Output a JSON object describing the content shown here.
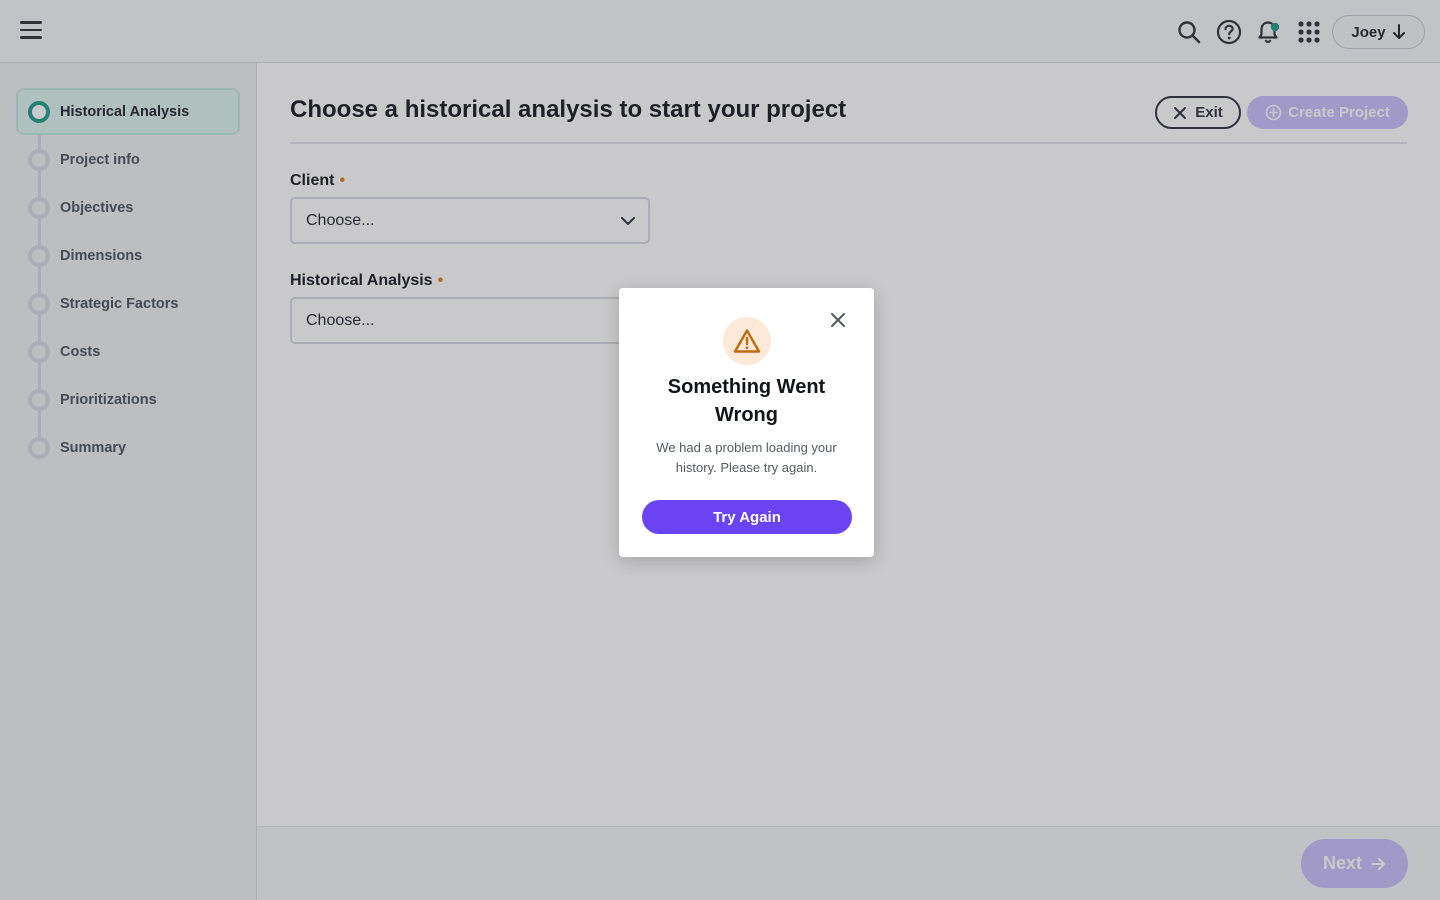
{
  "header": {
    "menu_icon": "hamburger-menu-icon",
    "icons": [
      "search-icon",
      "help-icon",
      "bell-icon",
      "apps-grid-icon"
    ],
    "notification_dot_color": "#1d9a8a",
    "user_name": "Joey"
  },
  "sidebar": {
    "steps": [
      {
        "label": "Historical Analysis",
        "active": true
      },
      {
        "label": "Project info",
        "active": false
      },
      {
        "label": "Objectives",
        "active": false
      },
      {
        "label": "Dimensions",
        "active": false
      },
      {
        "label": "Strategic Factors",
        "active": false
      },
      {
        "label": "Costs",
        "active": false
      },
      {
        "label": "Prioritizations",
        "active": false
      },
      {
        "label": "Summary",
        "active": false
      }
    ]
  },
  "main": {
    "title": "Choose a historical analysis to start your project",
    "exit_label": "Exit",
    "create_label": "Create Project",
    "client": {
      "label": "Client",
      "value": "Choose..."
    },
    "historical": {
      "label": "Historical Analysis",
      "value": "Choose..."
    },
    "next_label": "Next"
  },
  "modal": {
    "title": "Something Went Wrong",
    "message": "We had a problem loading your history.  Please try again.",
    "button": "Try Again"
  },
  "colors": {
    "accent_purple": "#6a44f2",
    "disabled_purple": "#c8bdfb",
    "active_teal": "#1d9a8a",
    "warning_orange": "#c06a12",
    "required_orange": "#e07a1f"
  }
}
